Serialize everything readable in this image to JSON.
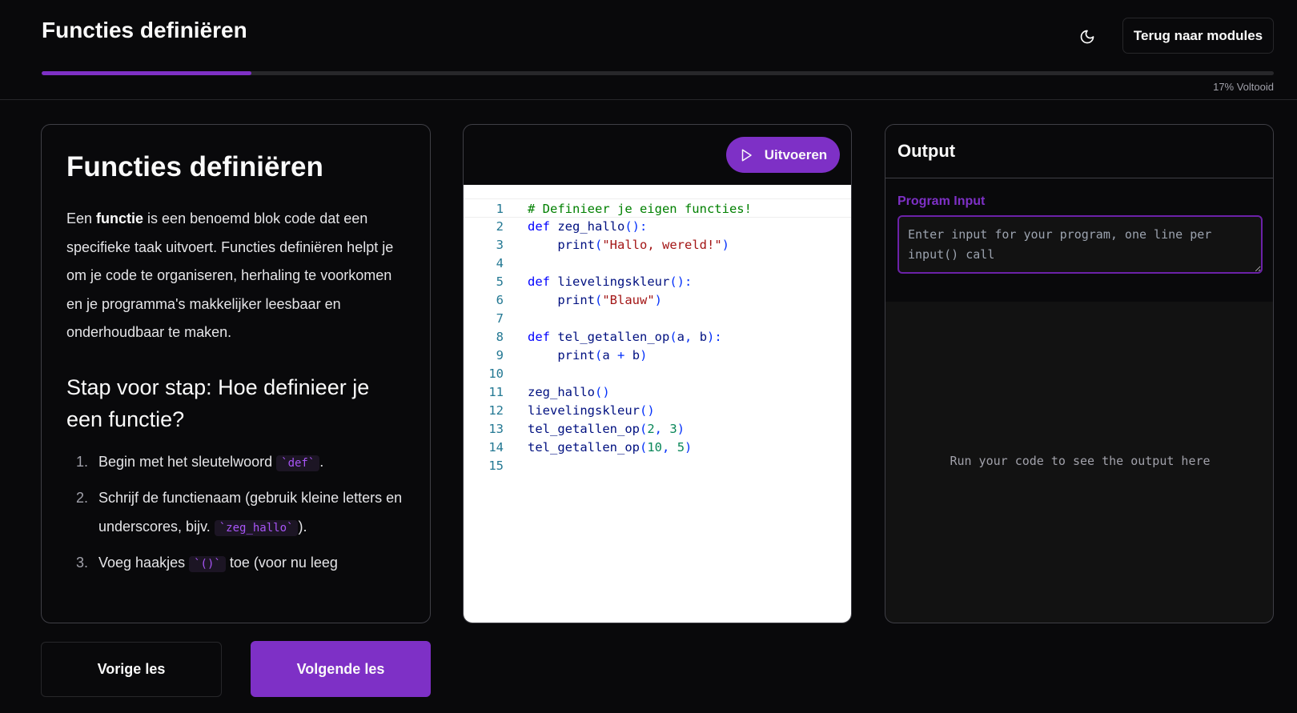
{
  "header": {
    "title": "Functies definiëren",
    "back_label": "Terug naar modules",
    "progress_fraction": 0.17,
    "progress_label": "17% Voltooid",
    "theme_icon": "moon-icon"
  },
  "lesson": {
    "title": "Functies definiëren",
    "intro_prefix": "Een ",
    "intro_bold": "functie",
    "intro_suffix": " is een benoemd blok code dat een specifieke taak uitvoert. Functies definiëren helpt je om je code te organiseren, herhaling te voorkomen en je programma's makkelijker leesbaar en onderhoudbaar te maken.",
    "steps_heading": "Stap voor stap: Hoe definieer je een functie?",
    "steps": [
      {
        "num": "1.",
        "before": "Begin met het sleutelwoord ",
        "code": "`def`",
        "after": "."
      },
      {
        "num": "2.",
        "before": "Schrijf de functienaam (gebruik kleine letters en underscores, bijv. ",
        "code": "`zeg_hallo`",
        "after": ")."
      },
      {
        "num": "3.",
        "before": "Voeg haakjes ",
        "code": "`()`",
        "after": " toe (voor nu leeg"
      }
    ]
  },
  "editor": {
    "run_label": "Uitvoeren",
    "run_icon": "play-icon",
    "active_line": 1,
    "lines": [
      "# Definieer je eigen functies!",
      "def zeg_hallo():",
      "    print(\"Hallo, wereld!\")",
      "",
      "def lievelingskleur():",
      "    print(\"Blauw\")",
      "",
      "def tel_getallen_op(a, b):",
      "    print(a + b)",
      "",
      "zeg_hallo()",
      "lievelingskleur()",
      "tel_getallen_op(2, 3)",
      "tel_getallen_op(10, 5)",
      ""
    ]
  },
  "output": {
    "title": "Output",
    "input_label": "Program Input",
    "input_placeholder": "Enter input for your program, one line per input() call",
    "input_value": "",
    "placeholder_text": "Run your code to see the output here"
  },
  "nav": {
    "prev_label": "Vorige les",
    "next_label": "Volgende les"
  },
  "colors": {
    "accent": "#7e30c6",
    "background": "#09090b",
    "border": "#3f3f46"
  }
}
